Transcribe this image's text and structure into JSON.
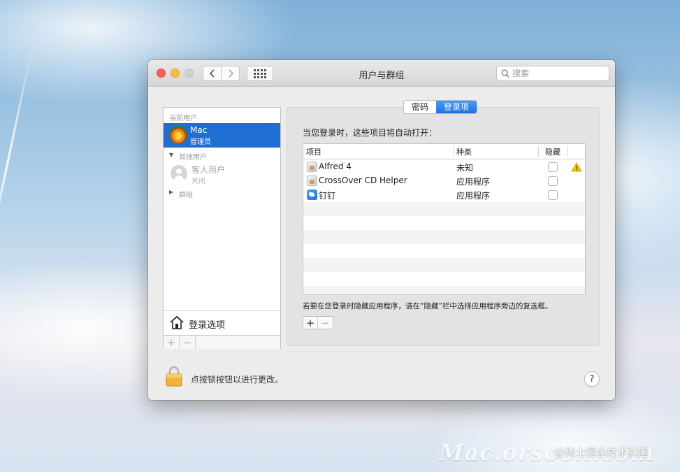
{
  "window": {
    "title": "用户与群组",
    "search_placeholder": "搜索"
  },
  "sidebar": {
    "current_users_label": "当前用户",
    "current_user": {
      "name": "Mac",
      "role": "管理员"
    },
    "other_users_label": "其他用户",
    "guest_user": {
      "name": "客人用户",
      "status": "关闭"
    },
    "groups_label": "群组",
    "login_options_label": "登录选项",
    "add_label": "+",
    "remove_label": "−"
  },
  "tabs": [
    {
      "label": "密码",
      "selected": false
    },
    {
      "label": "登录项",
      "selected": true
    }
  ],
  "login_items": {
    "intro": "当您登录时，这些项目将自动打开：",
    "columns": [
      "项目",
      "种类",
      "隐藏"
    ],
    "rows": [
      {
        "name": "Alfred 4",
        "kind": "未知",
        "hidden": false,
        "warning": true,
        "icon": "app-document-icon"
      },
      {
        "name": "CrossOver CD Helper",
        "kind": "应用程序",
        "hidden": false,
        "warning": false,
        "icon": "app-document-icon"
      },
      {
        "name": "钉钉",
        "kind": "应用程序",
        "hidden": false,
        "warning": false,
        "icon": "dingtalk-icon"
      }
    ],
    "hint": "若要在您登录时隐藏应用程序，请在“隐藏”栏中选择应用程序旁边的复选框。",
    "add_label": "+",
    "remove_label": "−"
  },
  "footer": {
    "lock_text": "点按锁按钮以进行更改。",
    "help_label": "?"
  },
  "overlay": {
    "watermark": "Mac.orsoon.com",
    "credit": "@稀土掘金技术社区"
  },
  "colors": {
    "accent": "#1f6ed4",
    "close": "#fc605b",
    "minimize": "#fdbc40",
    "warning": "#f5c000"
  }
}
